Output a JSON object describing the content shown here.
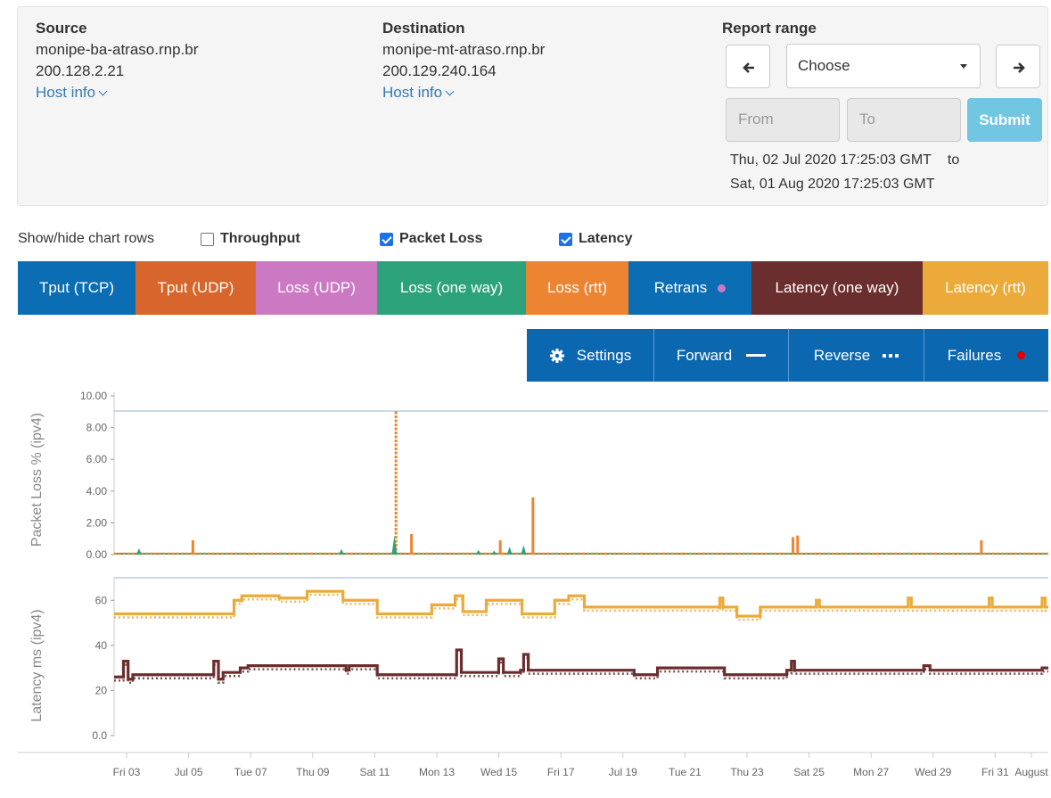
{
  "source": {
    "label": "Source",
    "host": "monipe-ba-atraso.rnp.br",
    "ip": "200.128.2.21",
    "info_link": "Host info"
  },
  "destination": {
    "label": "Destination",
    "host": "monipe-mt-atraso.rnp.br",
    "ip": "200.129.240.164",
    "info_link": "Host info"
  },
  "report_range": {
    "label": "Report range",
    "select_value": "Choose",
    "from_placeholder": "From",
    "to_placeholder": "To",
    "submit_label": "Submit",
    "range_start": "Thu, 02 Jul 2020 17:25:03 GMT",
    "range_sep": "to",
    "range_end": "Sat, 01 Aug 2020 17:25:03 GMT"
  },
  "show_hide": {
    "label": "Show/hide chart rows",
    "options": [
      {
        "label": "Throughput",
        "checked": false
      },
      {
        "label": "Packet Loss",
        "checked": true
      },
      {
        "label": "Latency",
        "checked": true
      }
    ]
  },
  "legend": [
    {
      "label": "Tput (TCP)",
      "color": "#0b6db3"
    },
    {
      "label": "Tput (UDP)",
      "color": "#d8652b"
    },
    {
      "label": "Loss (UDP)",
      "color": "#cc79c4"
    },
    {
      "label": "Loss (one way)",
      "color": "#2ca37a"
    },
    {
      "label": "Loss (rtt)",
      "color": "#ec8432"
    },
    {
      "label": "Retrans",
      "color": "#0b6db3",
      "dot_color": "#cc79c4"
    },
    {
      "label": "Latency (one way)",
      "color": "#6b2e2e"
    },
    {
      "label": "Latency (rtt)",
      "color": "#ebaa3a"
    }
  ],
  "options_bar": {
    "settings": "Settings",
    "forward": "Forward",
    "reverse": "Reverse",
    "failures": "Failures"
  },
  "chart_data": [
    {
      "type": "line",
      "ylabel": "Packet Loss % (ipv4)",
      "yticks": [
        "0.00",
        "2.00",
        "4.00",
        "6.00",
        "8.00",
        "10.00"
      ],
      "ylim": [
        0,
        10
      ],
      "x_ticks": [
        "Fri 03",
        "Jul 05",
        "Tue 07",
        "Thu 09",
        "Sat 11",
        "Mon 13",
        "Wed 15",
        "Fri 17",
        "Jul 19",
        "Tue 21",
        "Thu 23",
        "Sat 25",
        "Mon 27",
        "Wed 29",
        "Fri 31",
        "August"
      ],
      "series": [
        {
          "name": "Loss (rtt)",
          "color": "#ec8432",
          "spikes": [
            [
              2.53,
              0.9
            ],
            [
              9.05,
              9.1
            ],
            [
              9.55,
              1.3
            ],
            [
              12.4,
              0.9
            ],
            [
              13.45,
              3.6
            ],
            [
              21.8,
              1.1
            ],
            [
              21.95,
              1.2
            ],
            [
              27.85,
              0.9
            ]
          ]
        },
        {
          "name": "Loss (one way)",
          "color": "#2ca37a",
          "spikes": [
            [
              0.8,
              0.4
            ],
            [
              7.3,
              0.35
            ],
            [
              9.0,
              1.2
            ],
            [
              11.7,
              0.3
            ],
            [
              12.2,
              0.25
            ],
            [
              12.7,
              0.5
            ],
            [
              13.15,
              0.6
            ]
          ]
        }
      ]
    },
    {
      "type": "line",
      "ylabel": "Latency ms (ipv4)",
      "yticks": [
        "0.0",
        "20",
        "40",
        "60"
      ],
      "ylim": [
        0,
        70
      ],
      "series": [
        {
          "name": "Latency (rtt)",
          "color": "#ebaa3a",
          "steps": [
            [
              0,
              54
            ],
            [
              3.7,
              54
            ],
            [
              3.85,
              60
            ],
            [
              4.1,
              62
            ],
            [
              5.3,
              61
            ],
            [
              6.2,
              64
            ],
            [
              7.35,
              60
            ],
            [
              8.2,
              60
            ],
            [
              8.45,
              54
            ],
            [
              10.0,
              54
            ],
            [
              10.2,
              58
            ],
            [
              10.95,
              62
            ],
            [
              11.2,
              55
            ],
            [
              11.75,
              55
            ],
            [
              11.95,
              60
            ],
            [
              13.05,
              60
            ],
            [
              13.1,
              54
            ],
            [
              14.0,
              54
            ],
            [
              14.15,
              60
            ],
            [
              14.6,
              62
            ],
            [
              15.1,
              57
            ],
            [
              19.3,
              57
            ],
            [
              19.45,
              61
            ],
            [
              19.55,
              57
            ],
            [
              19.85,
              57
            ],
            [
              20.0,
              53
            ],
            [
              20.6,
              53
            ],
            [
              20.75,
              57
            ],
            [
              22.4,
              57
            ],
            [
              22.55,
              60
            ],
            [
              22.65,
              57
            ],
            [
              25.35,
              57
            ],
            [
              25.5,
              61
            ],
            [
              25.6,
              57
            ],
            [
              28.0,
              57
            ],
            [
              28.1,
              61
            ],
            [
              28.2,
              57
            ],
            [
              29.7,
              57
            ],
            [
              29.8,
              61
            ],
            [
              29.9,
              57
            ],
            [
              30,
              57
            ]
          ]
        },
        {
          "name": "Latency (one way)",
          "color": "#6b2e2e",
          "steps": [
            [
              0,
              26
            ],
            [
              0.3,
              33
            ],
            [
              0.45,
              25
            ],
            [
              0.6,
              27
            ],
            [
              3.05,
              27
            ],
            [
              3.2,
              33
            ],
            [
              3.35,
              25
            ],
            [
              3.5,
              28
            ],
            [
              4.05,
              30
            ],
            [
              4.3,
              31
            ],
            [
              7.45,
              29
            ],
            [
              7.55,
              31
            ],
            [
              8.45,
              27
            ],
            [
              10.8,
              27
            ],
            [
              11.0,
              38
            ],
            [
              11.15,
              28
            ],
            [
              12.2,
              28
            ],
            [
              12.35,
              34
            ],
            [
              12.5,
              28
            ],
            [
              13.05,
              29
            ],
            [
              13.15,
              36
            ],
            [
              13.3,
              29
            ],
            [
              16.5,
              29
            ],
            [
              16.7,
              27
            ],
            [
              17.2,
              27
            ],
            [
              17.45,
              30
            ],
            [
              19.5,
              30
            ],
            [
              19.6,
              27
            ],
            [
              20.8,
              27
            ],
            [
              21.6,
              29
            ],
            [
              21.75,
              33
            ],
            [
              21.85,
              29
            ],
            [
              25.8,
              29
            ],
            [
              26.0,
              31
            ],
            [
              26.2,
              29
            ],
            [
              29.8,
              30
            ],
            [
              30,
              30
            ]
          ]
        }
      ]
    }
  ]
}
